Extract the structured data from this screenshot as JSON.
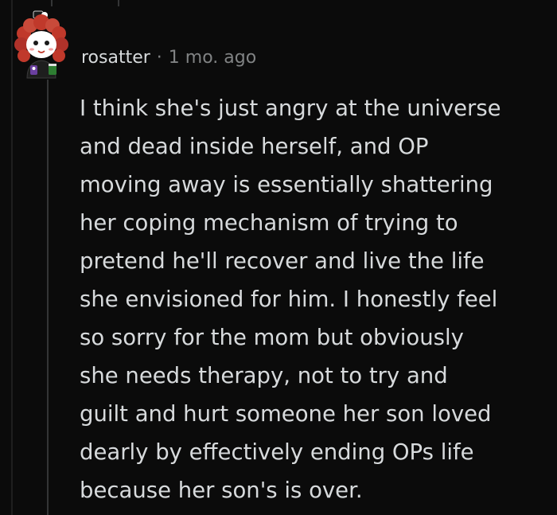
{
  "comment": {
    "username": "rosatter",
    "separator": "·",
    "timestamp": "1 mo. ago",
    "body_lines": [
      "I think she's just angry at the universe",
      "and dead inside herself, and OP",
      "moving away is essentially shattering",
      "her coping mechanism of trying to",
      "pretend he'll recover and live the life",
      "she envisioned for him. I honestly feel",
      "so sorry for the mom but obviously",
      "she needs therapy, not to try and",
      "guilt and hurt someone her son loved",
      "dearly by effectively ending OPs life",
      "because her son's is over."
    ]
  },
  "avatar": {
    "icon": "user-avatar-icon",
    "hair_color": "#c0392b",
    "background": "#0b0b0b"
  },
  "colors": {
    "background": "#0b0b0b",
    "text": "#d7dadc",
    "muted": "#818384",
    "thread_line": "#343536"
  }
}
